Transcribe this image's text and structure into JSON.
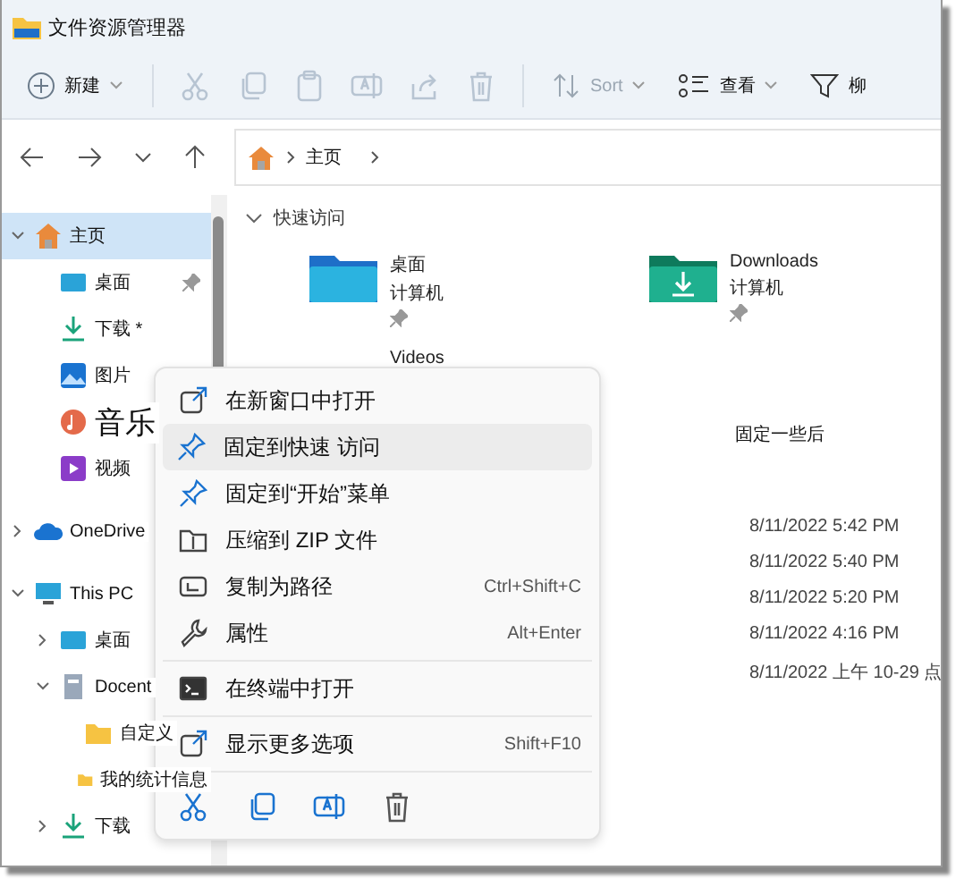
{
  "window": {
    "title": "文件资源管理器"
  },
  "toolbar": {
    "new_button": {
      "label": "新建"
    },
    "actions": [
      {
        "kind": "cut",
        "disabled": true
      },
      {
        "kind": "copy",
        "disabled": true
      },
      {
        "kind": "paste",
        "disabled": true
      },
      {
        "kind": "rename",
        "disabled": true
      },
      {
        "kind": "share",
        "disabled": true
      },
      {
        "kind": "delete",
        "disabled": true
      }
    ],
    "sort": {
      "label": "Sort",
      "disabled": true
    },
    "view": {
      "label": "查看"
    },
    "filter": {
      "label": "柳"
    }
  },
  "address_bar": {
    "crumbs": [
      "主页"
    ]
  },
  "sidebar": {
    "items": [
      {
        "label": "主页",
        "kind": "home",
        "selected": true,
        "expanded": true,
        "children": [
          {
            "label": "桌面",
            "kind": "desktop",
            "pinned": true
          },
          {
            "label": "下载 *",
            "kind": "download",
            "pinned": false
          },
          {
            "label": "图片",
            "kind": "pictures",
            "pinned": false
          },
          {
            "label": "音乐",
            "kind": "music",
            "pinned": false,
            "large": true
          },
          {
            "label": "视频",
            "kind": "video",
            "pinned": false
          }
        ]
      },
      {
        "label": "OneDrive",
        "kind": "cloud",
        "selected": false,
        "expanded": false
      },
      {
        "label": "This PC",
        "kind": "pc",
        "selected": false,
        "expanded": true,
        "children": [
          {
            "label": "桌面",
            "kind": "desktop",
            "expanded": false
          },
          {
            "label": "Docent",
            "kind": "doc",
            "expanded": true,
            "children": [
              {
                "label": "自定义",
                "kind": "folder"
              },
              {
                "label": "我的统计信息",
                "kind": "folder"
              }
            ]
          },
          {
            "label": "下载",
            "kind": "download",
            "expanded": false
          }
        ]
      }
    ]
  },
  "quick_access": {
    "header": "快速访问",
    "expanded": true,
    "items": [
      {
        "name": "桌面",
        "location": "计算机",
        "pinned": true,
        "kind": "desktop"
      },
      {
        "name": "Downloads",
        "location": "计算机",
        "pinned": true,
        "kind": "downloads"
      },
      {
        "name": "Videos",
        "kind": "videos"
      }
    ]
  },
  "recent": {
    "header": "固定一些后",
    "dates": [
      "8/11/2022 5:42 PM",
      "8/11/2022 5:40 PM",
      "8/11/2022 5:20 PM",
      "8/11/2022 4:16 PM",
      "8/11/2022 上午 10-29 点"
    ]
  },
  "context_menu": {
    "sections": [
      [
        {
          "kind": "open_window",
          "label": "在新窗口中打开",
          "highlighted": false
        },
        {
          "kind": "pin",
          "label": "固定到快速 访问",
          "highlighted": true
        },
        {
          "kind": "pin",
          "label": "固定到“开始”菜单",
          "highlighted": false
        },
        {
          "kind": "zip",
          "label": "压缩到 ZIP 文件",
          "highlighted": false
        },
        {
          "kind": "path",
          "label": "复制为路径",
          "shortcut": "Ctrl+Shift+C",
          "highlighted": false
        },
        {
          "kind": "wrench",
          "label": "属性",
          "shortcut": "Alt+Enter",
          "highlighted": false
        }
      ],
      [
        {
          "kind": "terminal",
          "label": "在终端中打开",
          "highlighted": false
        }
      ],
      [
        {
          "kind": "more",
          "label": "显示更多选项",
          "shortcut": "Shift+F10",
          "highlighted": false
        }
      ]
    ],
    "bottom_actions": [
      {
        "kind": "cut"
      },
      {
        "kind": "copy"
      },
      {
        "kind": "rename"
      },
      {
        "kind": "delete"
      }
    ]
  }
}
